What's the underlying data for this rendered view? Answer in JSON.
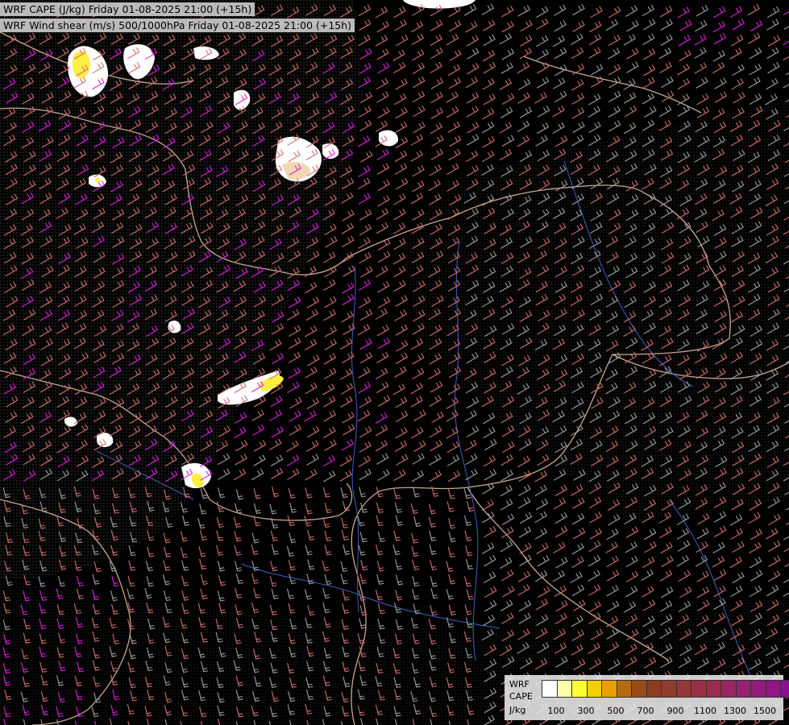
{
  "titles": {
    "cape": "WRF CAPE (J/kg) Friday 01-08-2025 21:00 (+15h)",
    "shear": "WRF Wind shear (m/s) 500/1000hPa Friday 01-08-2025 21:00 (+15h)"
  },
  "legend": {
    "line1": "WRF",
    "line2": "CAPE",
    "line3": "J/kg",
    "colors": [
      "#ffffff",
      "#ffffaa",
      "#ffff33",
      "#f5d000",
      "#e8a000",
      "#b86a10",
      "#9a4a18",
      "#8e3c20",
      "#913a2e",
      "#963638",
      "#993144",
      "#992c50",
      "#992660",
      "#99206e",
      "#951a7a",
      "#901585",
      "#8a1090"
    ],
    "ticks": [
      "100",
      "300",
      "500",
      "700",
      "900",
      "1100",
      "1300",
      "1500"
    ]
  },
  "colors": {
    "background": "#000000",
    "border": "#c8a890",
    "river": "#4060c0",
    "barb_low": "#a0a0a0",
    "barb_mid": "#d07070",
    "barb_high": "#e020e0"
  }
}
